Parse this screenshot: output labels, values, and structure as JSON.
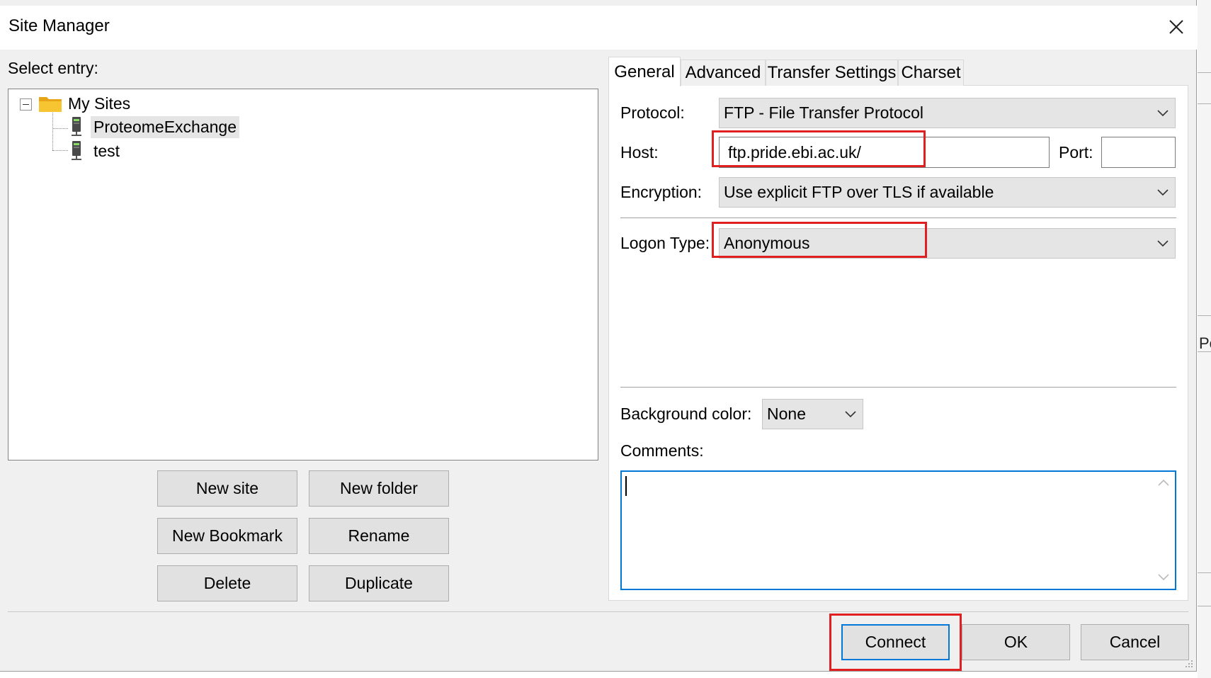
{
  "window": {
    "title": "Site Manager"
  },
  "left": {
    "select_entry_label": "Select entry:",
    "tree": {
      "root": "My Sites",
      "items": [
        "ProteomeExchange",
        "test"
      ]
    },
    "buttons": {
      "new_site": "New site",
      "new_folder": "New folder",
      "new_bookmark": "New Bookmark",
      "rename": "Rename",
      "delete": "Delete",
      "duplicate": "Duplicate"
    }
  },
  "tabs": [
    "General",
    "Advanced",
    "Transfer Settings",
    "Charset"
  ],
  "general": {
    "protocol_label": "Protocol:",
    "protocol_value": "FTP - File Transfer Protocol",
    "host_label": "Host:",
    "host_value": "ftp.pride.ebi.ac.uk/",
    "port_label": "Port:",
    "port_value": "",
    "encryption_label": "Encryption:",
    "encryption_value": "Use explicit FTP over TLS if available",
    "logon_label": "Logon Type:",
    "logon_value": "Anonymous",
    "bgcolor_label": "Background color:",
    "bgcolor_value": "None",
    "comments_label": "Comments:",
    "comments_value": ""
  },
  "footer": {
    "connect": "Connect",
    "ok": "OK",
    "cancel": "Cancel"
  },
  "background_app": {
    "partial_label": "Pe"
  },
  "colors": {
    "highlight": "#e02020",
    "focus_border": "#0078d7"
  },
  "icons": [
    "close-icon",
    "folder-icon",
    "server-icon",
    "chevron-down-icon",
    "scroll-up-icon",
    "scroll-down-icon",
    "resize-grip-icon"
  ]
}
